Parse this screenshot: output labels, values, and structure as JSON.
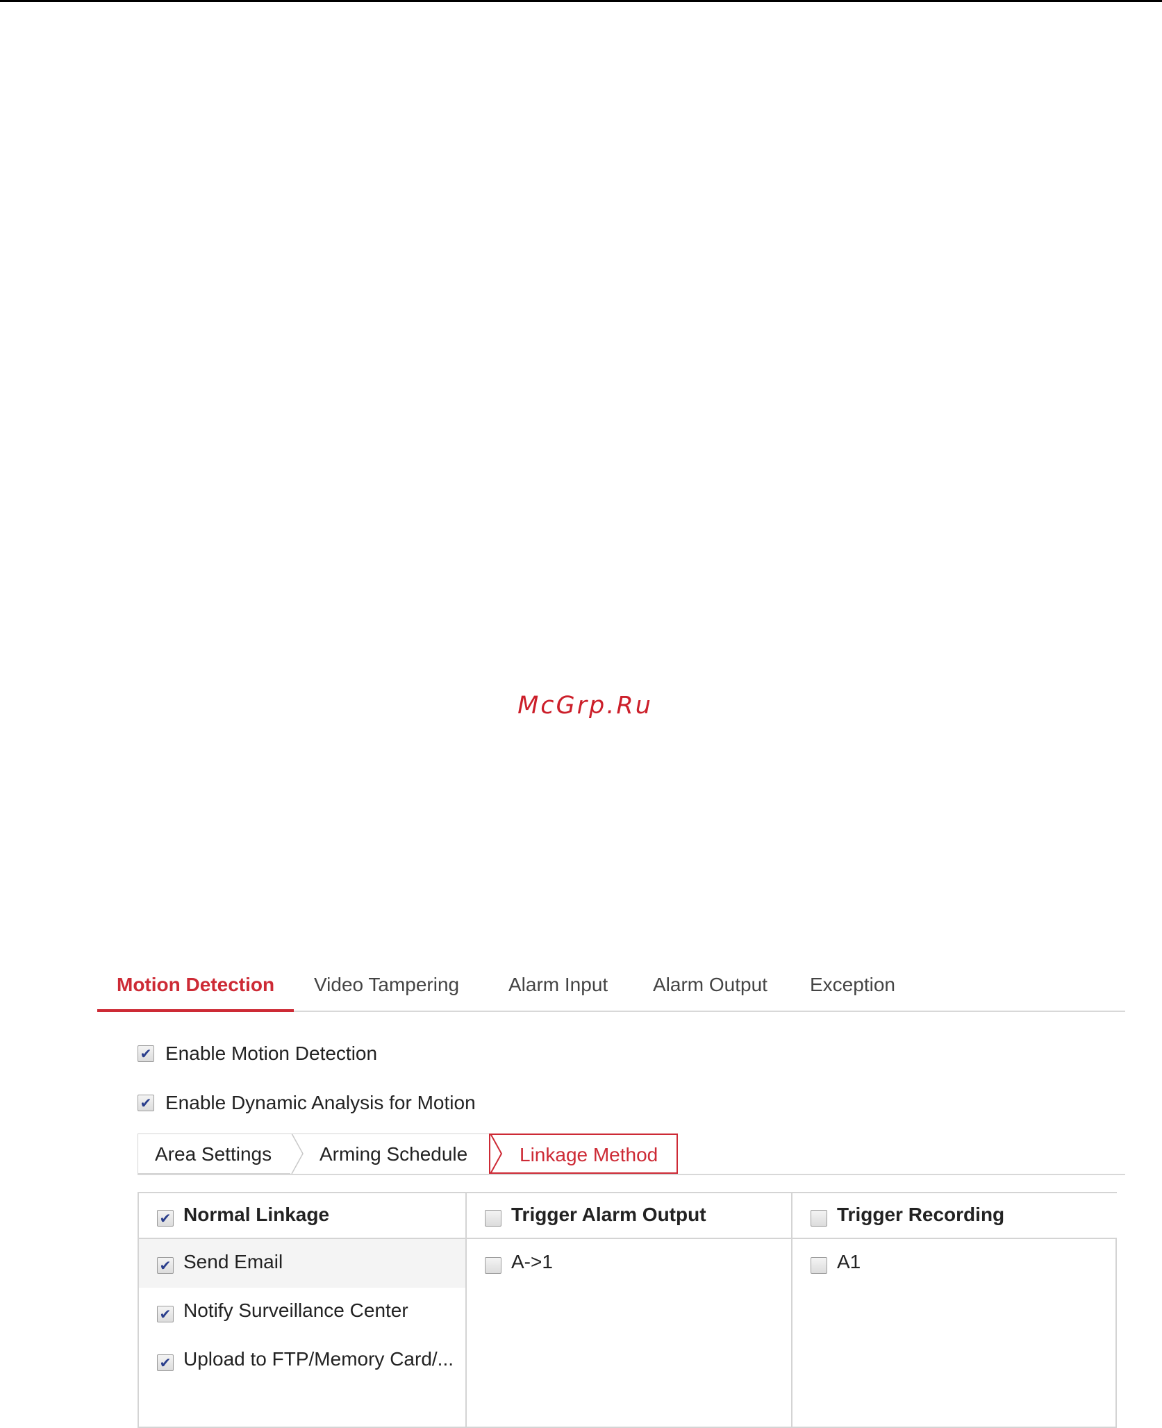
{
  "watermark": "McGrp.Ru",
  "main_tabs": [
    {
      "label": "Motion Detection",
      "active": true
    },
    {
      "label": "Video Tampering",
      "active": false
    },
    {
      "label": "Alarm Input",
      "active": false
    },
    {
      "label": "Alarm Output",
      "active": false
    },
    {
      "label": "Exception",
      "active": false
    }
  ],
  "options": {
    "enable_motion_detection": {
      "label": "Enable Motion Detection",
      "checked": true
    },
    "enable_dynamic_analysis": {
      "label": "Enable Dynamic Analysis for Motion",
      "checked": true
    }
  },
  "sub_tabs": [
    {
      "label": "Area Settings",
      "active": false
    },
    {
      "label": "Arming Schedule",
      "active": false
    },
    {
      "label": "Linkage Method",
      "active": true
    }
  ],
  "linkage": {
    "normal": {
      "header": "Normal Linkage",
      "checked": true,
      "items": [
        {
          "label": "Send Email",
          "checked": true
        },
        {
          "label": "Notify Surveillance Center",
          "checked": true
        },
        {
          "label": "Upload to FTP/Memory Card/...",
          "checked": true
        }
      ]
    },
    "alarm_output": {
      "header": "Trigger Alarm Output",
      "checked": false,
      "items": [
        {
          "label": "A->1",
          "checked": false
        }
      ]
    },
    "recording": {
      "header": "Trigger Recording",
      "checked": false,
      "items": [
        {
          "label": "A1",
          "checked": false
        }
      ]
    }
  },
  "colors": {
    "accent": "#cd2a35",
    "border": "#d4d4d4",
    "check": "#2a3e8c"
  }
}
